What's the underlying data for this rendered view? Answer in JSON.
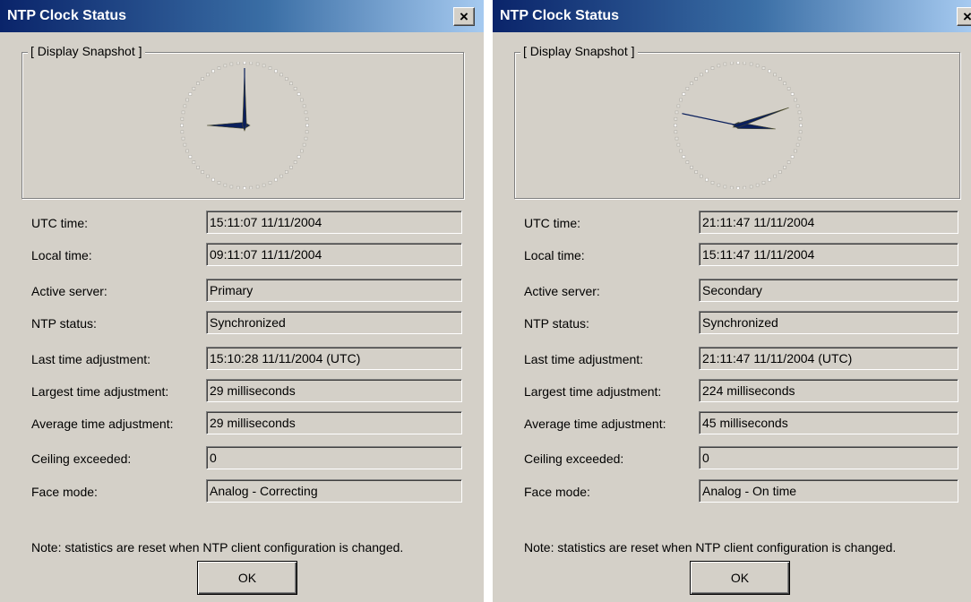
{
  "dialogs": [
    {
      "title": "NTP Clock Status",
      "close_label": "×",
      "group_label": "[ Display Snapshot ]",
      "clock": {
        "hour": 9,
        "minute": 0,
        "second": 0
      },
      "rows": [
        {
          "label": "UTC time:",
          "value": "15:11:07 11/11/2004"
        },
        {
          "label": "Local time:",
          "value": "09:11:07 11/11/2004"
        },
        {
          "label": "Active server:",
          "value": "Primary"
        },
        {
          "label": "NTP status:",
          "value": "Synchronized"
        },
        {
          "label": "Last time adjustment:",
          "value": "15:10:28 11/11/2004 (UTC)"
        },
        {
          "label": "Largest time adjustment:",
          "value": "29 milliseconds"
        },
        {
          "label": "Average time adjustment:",
          "value": "29 milliseconds"
        },
        {
          "label": "Ceiling exceeded:",
          "value": "0"
        },
        {
          "label": "Face mode:",
          "value": "Analog - Correcting"
        }
      ],
      "note": "Note: statistics are reset when NTP client configuration is changed.",
      "ok_label": "OK"
    },
    {
      "title": "NTP Clock Status",
      "close_label": "×",
      "group_label": "[ Display Snapshot ]",
      "clock": {
        "hour": 15,
        "minute": 11,
        "second": 47
      },
      "rows": [
        {
          "label": "UTC time:",
          "value": "21:11:47 11/11/2004"
        },
        {
          "label": "Local time:",
          "value": "15:11:47 11/11/2004"
        },
        {
          "label": "Active server:",
          "value": "Secondary"
        },
        {
          "label": "NTP status:",
          "value": "Synchronized"
        },
        {
          "label": "Last time adjustment:",
          "value": "21:11:47 11/11/2004 (UTC)"
        },
        {
          "label": "Largest time adjustment:",
          "value": "224 milliseconds"
        },
        {
          "label": "Average time adjustment:",
          "value": "45 milliseconds"
        },
        {
          "label": "Ceiling exceeded:",
          "value": "0"
        },
        {
          "label": "Face mode:",
          "value": "Analog - On time"
        }
      ],
      "note": "Note: statistics are reset when NTP client configuration is changed.",
      "ok_label": "OK"
    }
  ],
  "colors": {
    "dialog_bg": "#d4d0c8",
    "titlebar_start": "#0a246a",
    "titlebar_end": "#a6caf0",
    "clock_hand": "#0a1f5c"
  }
}
